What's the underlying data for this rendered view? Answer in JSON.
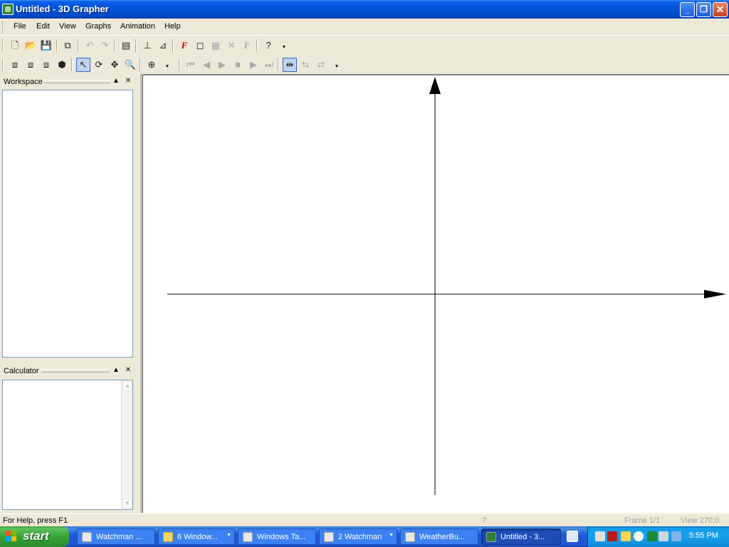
{
  "window": {
    "title": "Untitled - 3D Grapher"
  },
  "menu": [
    "File",
    "Edit",
    "View",
    "Graphs",
    "Animation",
    "Help"
  ],
  "toolbar1": {
    "buttons": [
      {
        "icon": "new-icon",
        "glyph": "🗋",
        "enabled": true
      },
      {
        "icon": "open-icon",
        "glyph": "📂",
        "enabled": true
      },
      {
        "icon": "save-icon",
        "glyph": "💾",
        "enabled": true
      },
      {
        "icon": "copy-icon",
        "glyph": "⧉",
        "enabled": true
      },
      {
        "icon": "undo-icon",
        "glyph": "↶",
        "enabled": false
      },
      {
        "icon": "redo-icon",
        "glyph": "↷",
        "enabled": false
      },
      {
        "icon": "view-icon",
        "glyph": "▤",
        "enabled": true
      },
      {
        "icon": "axis-icon",
        "glyph": "⊥",
        "enabled": true
      },
      {
        "icon": "plane-icon",
        "glyph": "⊿",
        "enabled": true
      },
      {
        "icon": "add-function-icon",
        "glyph": "F",
        "enabled": true
      },
      {
        "icon": "add-object-icon",
        "glyph": "◻",
        "enabled": true
      },
      {
        "icon": "properties-icon",
        "glyph": "▦",
        "enabled": false
      },
      {
        "icon": "delete-icon",
        "glyph": "✕",
        "enabled": false
      },
      {
        "icon": "function-disabled-icon",
        "glyph": "F",
        "enabled": false
      },
      {
        "icon": "help-icon",
        "glyph": "?",
        "enabled": true
      }
    ]
  },
  "toolbar2": {
    "buttons": [
      {
        "icon": "front-view-icon",
        "glyph": "⧈",
        "enabled": true
      },
      {
        "icon": "side-view-icon",
        "glyph": "⧈",
        "enabled": true
      },
      {
        "icon": "top-view-icon",
        "glyph": "⧈",
        "enabled": true
      },
      {
        "icon": "3d-view-icon",
        "glyph": "⬢",
        "enabled": true
      },
      {
        "icon": "select-icon",
        "glyph": "↖",
        "enabled": true,
        "active": true
      },
      {
        "icon": "rotate-icon",
        "glyph": "⟳",
        "enabled": true
      },
      {
        "icon": "pan-icon",
        "glyph": "✥",
        "enabled": true
      },
      {
        "icon": "zoom-icon",
        "glyph": "🔍",
        "enabled": true
      },
      {
        "icon": "zoom-options-icon",
        "glyph": "⊕",
        "enabled": true
      },
      {
        "icon": "first-frame-icon",
        "glyph": "⏮",
        "enabled": false
      },
      {
        "icon": "prev-frame-icon",
        "glyph": "◀",
        "enabled": false
      },
      {
        "icon": "play-icon",
        "glyph": "▶",
        "enabled": false
      },
      {
        "icon": "stop-icon",
        "glyph": "■",
        "enabled": false
      },
      {
        "icon": "next-frame-icon",
        "glyph": "▶",
        "enabled": false
      },
      {
        "icon": "last-frame-icon",
        "glyph": "⏭",
        "enabled": false
      },
      {
        "icon": "frame-mode-icon",
        "glyph": "⇹",
        "enabled": true,
        "active": true
      },
      {
        "icon": "loop-icon",
        "glyph": "⇆",
        "enabled": false
      },
      {
        "icon": "bounce-icon",
        "glyph": "⇄",
        "enabled": false
      }
    ]
  },
  "workspace": {
    "title": "Workspace"
  },
  "calculator": {
    "title": "Calculator"
  },
  "status": {
    "help": "For Help, press F1",
    "indicator": "?",
    "frame": "Frame 1/1",
    "view": "View 270;0"
  },
  "taskbar": {
    "start_label": "start",
    "tasks": [
      {
        "label": "Watchman ...",
        "arrow": false,
        "active": false
      },
      {
        "label": "6 Window...",
        "arrow": true,
        "active": false
      },
      {
        "label": "Windows Ta...",
        "arrow": false,
        "active": false
      },
      {
        "label": "2 Watchman",
        "arrow": true,
        "active": false
      },
      {
        "label": "WeatherBu...",
        "arrow": false,
        "active": false
      },
      {
        "label": "Untitled - 3...",
        "arrow": false,
        "active": true
      }
    ],
    "clock": "5:55 PM"
  },
  "colors": {
    "title_bar": "#0052d6",
    "taskbar": "#2157d7",
    "start": "#36a336",
    "axis": "#000000"
  }
}
